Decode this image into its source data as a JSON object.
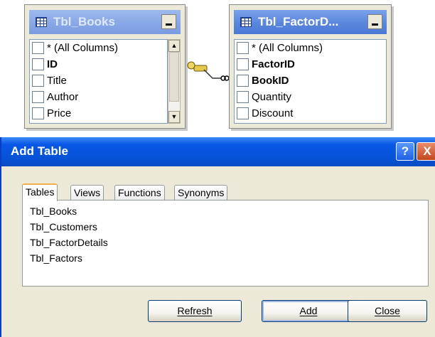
{
  "left_table": {
    "title": "Tbl_Books",
    "columns": [
      "* (All Columns)",
      "ID",
      "Title",
      "Author",
      "Price"
    ],
    "bold_columns": [
      "ID"
    ]
  },
  "right_table": {
    "title": "Tbl_FactorD...",
    "columns": [
      "* (All Columns)",
      "FactorID",
      "BookID",
      "Quantity",
      "Discount"
    ],
    "bold_columns": [
      "FactorID",
      "BookID"
    ]
  },
  "dialog": {
    "title": "Add Table",
    "help_glyph": "?",
    "close_glyph": "X",
    "tabs": [
      "Tables",
      "Views",
      "Functions",
      "Synonyms"
    ],
    "active_tab": "Tables",
    "tables": [
      "Tbl_Books",
      "Tbl_Customers",
      "Tbl_FactorDetails",
      "Tbl_Factors"
    ],
    "buttons": {
      "refresh": "Refresh",
      "add": "Add",
      "close": "Close"
    }
  },
  "icons": {
    "table": "table-grid-icon",
    "relation": "key-relation-icon"
  }
}
